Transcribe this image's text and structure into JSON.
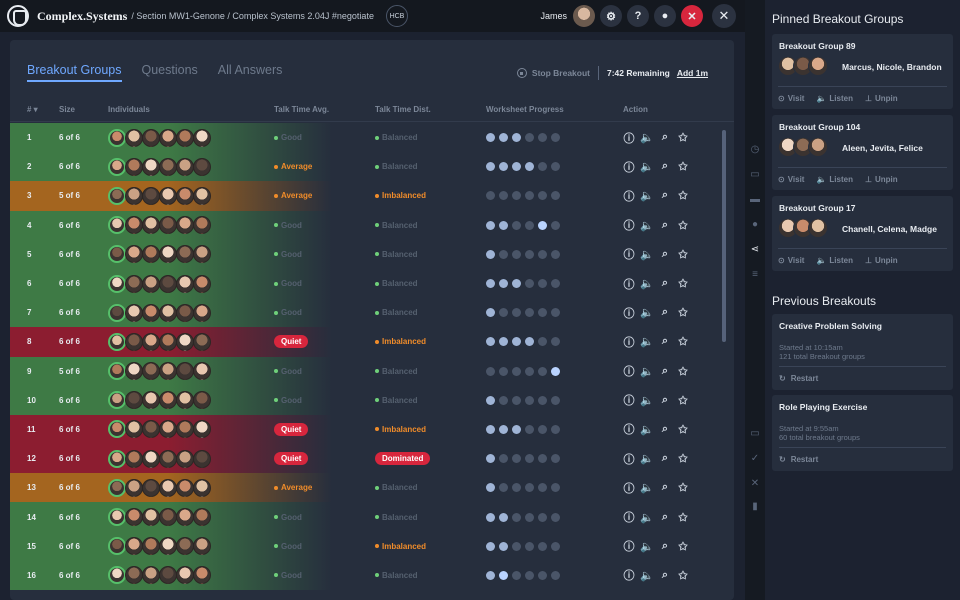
{
  "topbar": {
    "brand": "Complex.Systems",
    "breadcrumb": "/ Section MW1-Genone / Complex Systems 2.04J #negotiate",
    "hcb": "HCB",
    "user": "James"
  },
  "tabs": [
    {
      "label": "Breakout Groups",
      "active": true
    },
    {
      "label": "Questions",
      "active": false
    },
    {
      "label": "All Answers",
      "active": false
    }
  ],
  "controls": {
    "stop_label": "Stop Breakout",
    "remaining": "7:42 Remaining",
    "add_time": "Add 1m"
  },
  "table": {
    "headers": {
      "num": "#",
      "size": "Size",
      "individuals": "Individuals",
      "talk_avg": "Talk Time Avg.",
      "talk_dist": "Talk Time Dist.",
      "progress": "Worksheet Progress",
      "action": "Action"
    },
    "rows": [
      {
        "num": "1",
        "size": "6 of 6",
        "tone": "green",
        "talk": "Good",
        "talk_kind": "good",
        "dist": "Balanced",
        "dist_kind": "good",
        "progress": [
          1,
          1,
          1,
          0,
          0,
          0
        ],
        "cur": -1
      },
      {
        "num": "2",
        "size": "6 of 6",
        "tone": "green",
        "talk": "Average",
        "talk_kind": "warn",
        "dist": "Balanced",
        "dist_kind": "good",
        "progress": [
          1,
          1,
          1,
          1,
          0,
          0
        ],
        "cur": -1
      },
      {
        "num": "3",
        "size": "5 of 6",
        "tone": "orange",
        "talk": "Average",
        "talk_kind": "warn",
        "dist": "Imbalanced",
        "dist_kind": "warn",
        "progress": [
          0,
          0,
          0,
          0,
          0,
          0
        ],
        "cur": -1
      },
      {
        "num": "4",
        "size": "6 of 6",
        "tone": "green",
        "talk": "Good",
        "talk_kind": "good",
        "dist": "Balanced",
        "dist_kind": "good",
        "progress": [
          1,
          1,
          0,
          0,
          0,
          0
        ],
        "cur": 4
      },
      {
        "num": "5",
        "size": "6 of 6",
        "tone": "green",
        "talk": "Good",
        "talk_kind": "good",
        "dist": "Balanced",
        "dist_kind": "good",
        "progress": [
          1,
          0,
          0,
          0,
          0,
          0
        ],
        "cur": -1
      },
      {
        "num": "6",
        "size": "6 of 6",
        "tone": "green",
        "talk": "Good",
        "talk_kind": "good",
        "dist": "Balanced",
        "dist_kind": "good",
        "progress": [
          1,
          1,
          1,
          0,
          0,
          0
        ],
        "cur": -1
      },
      {
        "num": "7",
        "size": "6 of 6",
        "tone": "green",
        "talk": "Good",
        "talk_kind": "good",
        "dist": "Balanced",
        "dist_kind": "good",
        "progress": [
          1,
          0,
          0,
          0,
          0,
          0
        ],
        "cur": -1
      },
      {
        "num": "8",
        "size": "6 of 6",
        "tone": "red",
        "talk": "Quiet",
        "talk_kind": "badge",
        "dist": "Imbalanced",
        "dist_kind": "warn",
        "progress": [
          1,
          1,
          1,
          1,
          0,
          0
        ],
        "cur": -1
      },
      {
        "num": "9",
        "size": "5 of 6",
        "tone": "green",
        "talk": "Good",
        "talk_kind": "good",
        "dist": "Balanced",
        "dist_kind": "good",
        "progress": [
          0,
          0,
          0,
          0,
          0,
          0
        ],
        "cur": 5
      },
      {
        "num": "10",
        "size": "6 of 6",
        "tone": "green",
        "talk": "Good",
        "talk_kind": "good",
        "dist": "Balanced",
        "dist_kind": "good",
        "progress": [
          1,
          0,
          0,
          0,
          0,
          0
        ],
        "cur": -1
      },
      {
        "num": "11",
        "size": "6 of 6",
        "tone": "red",
        "talk": "Quiet",
        "talk_kind": "badge",
        "dist": "Imbalanced",
        "dist_kind": "warn",
        "progress": [
          1,
          1,
          1,
          0,
          0,
          0
        ],
        "cur": -1
      },
      {
        "num": "12",
        "size": "6 of 6",
        "tone": "red",
        "talk": "Quiet",
        "talk_kind": "badge",
        "dist": "Dominated",
        "dist_kind": "badge",
        "progress": [
          1,
          0,
          0,
          0,
          0,
          0
        ],
        "cur": -1
      },
      {
        "num": "13",
        "size": "6 of 6",
        "tone": "orange",
        "talk": "Average",
        "talk_kind": "warn",
        "dist": "Balanced",
        "dist_kind": "good",
        "progress": [
          1,
          0,
          0,
          0,
          0,
          0
        ],
        "cur": -1
      },
      {
        "num": "14",
        "size": "6 of 6",
        "tone": "green",
        "talk": "Good",
        "talk_kind": "good",
        "dist": "Balanced",
        "dist_kind": "good",
        "progress": [
          1,
          1,
          0,
          0,
          0,
          0
        ],
        "cur": -1
      },
      {
        "num": "15",
        "size": "6 of 6",
        "tone": "green",
        "talk": "Good",
        "talk_kind": "good",
        "dist": "Imbalanced",
        "dist_kind": "warn",
        "progress": [
          1,
          1,
          0,
          0,
          0,
          0
        ],
        "cur": -1
      },
      {
        "num": "16",
        "size": "6 of 6",
        "tone": "green",
        "talk": "Good",
        "talk_kind": "good",
        "dist": "Balanced",
        "dist_kind": "good",
        "progress": [
          1,
          1,
          0,
          0,
          0,
          0
        ],
        "cur": 1
      }
    ]
  },
  "pinned": {
    "title": "Pinned Breakout Groups",
    "cards": [
      {
        "title": "Breakout Group 89",
        "names": "Marcus, Nicole, Brandon"
      },
      {
        "title": "Breakout Group 104",
        "names": "Aleen, Jevita, Felice"
      },
      {
        "title": "Breakout Group 17",
        "names": "Chanell, Celena, Madge"
      }
    ],
    "visit": "Visit",
    "listen": "Listen",
    "unpin": "Unpin"
  },
  "previous": {
    "title": "Previous Breakouts",
    "items": [
      {
        "title": "Creative Problem Solving",
        "started": "Started at 10:15am",
        "total": "121 total Breakout groups"
      },
      {
        "title": "Role Playing Exercise",
        "started": "Started at 9:55am",
        "total": "60 total breakout groups"
      }
    ],
    "restart": "Restart"
  },
  "colors": {
    "green": "#3e7a45",
    "orange": "#a4651f",
    "red": "#8c1d30",
    "good": "#6fd07a",
    "warn": "#f08c2a",
    "badge": "#d7263d",
    "accent": "#6fa8ff"
  }
}
